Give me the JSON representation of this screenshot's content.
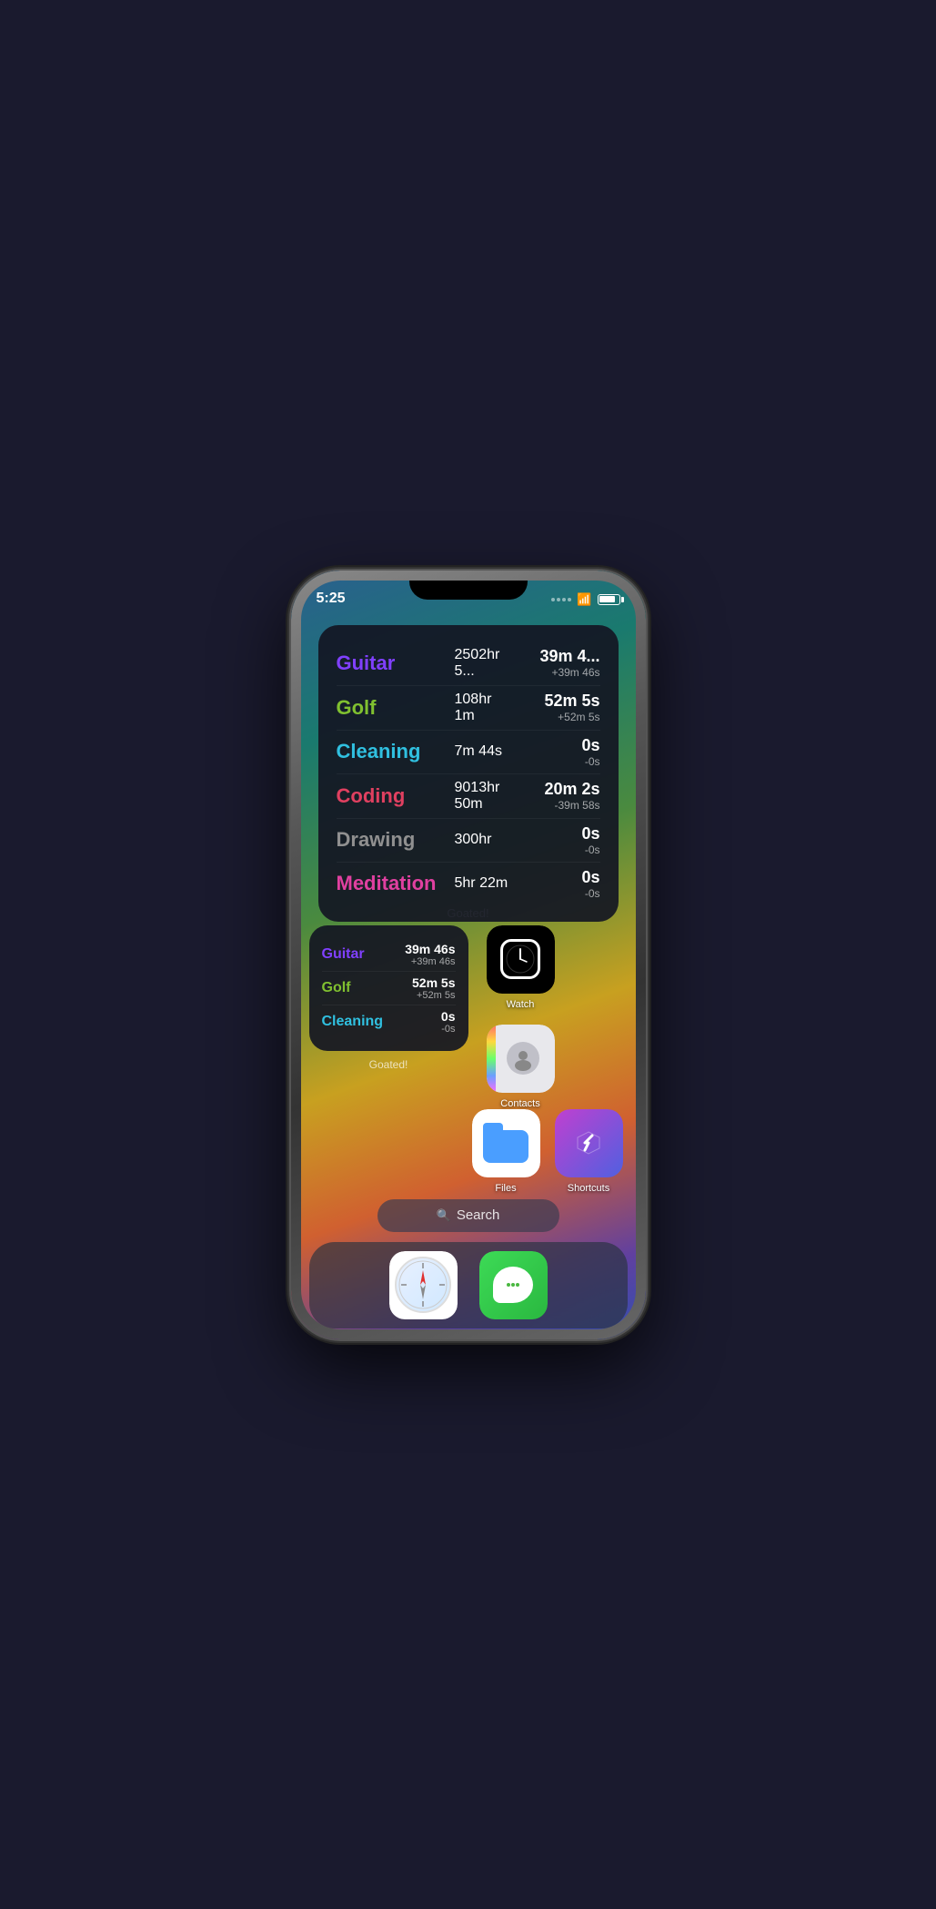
{
  "phone": {
    "time": "5:25"
  },
  "large_widget": {
    "label": "Goated!",
    "rows": [
      {
        "name": "Guitar",
        "color_class": "color-guitar",
        "total": "2502hr 5...",
        "today_main": "39m 4...",
        "today_sub": "+39m 46s"
      },
      {
        "name": "Golf",
        "color_class": "color-golf",
        "total": "108hr 1m",
        "today_main": "52m 5s",
        "today_sub": "+52m 5s"
      },
      {
        "name": "Cleaning",
        "color_class": "color-cleaning",
        "total": "7m 44s",
        "today_main": "0s",
        "today_sub": "-0s"
      },
      {
        "name": "Coding",
        "color_class": "color-coding",
        "total": "9013hr 50m",
        "today_main": "20m 2s",
        "today_sub": "-39m 58s"
      },
      {
        "name": "Drawing",
        "color_class": "color-drawing",
        "total": "300hr",
        "today_main": "0s",
        "today_sub": "-0s"
      },
      {
        "name": "Meditation",
        "color_class": "color-meditation",
        "total": "5hr 22m",
        "today_main": "0s",
        "today_sub": "-0s"
      }
    ]
  },
  "small_widget": {
    "label": "Goated!",
    "rows": [
      {
        "name": "Guitar",
        "color_class": "color-guitar",
        "today_main": "39m 46s",
        "today_sub": "+39m 46s"
      },
      {
        "name": "Golf",
        "color_class": "color-golf",
        "today_main": "52m 5s",
        "today_sub": "+52m 5s"
      },
      {
        "name": "Cleaning",
        "color_class": "color-cleaning",
        "today_main": "0s",
        "today_sub": "-0s"
      }
    ]
  },
  "apps": {
    "watch": {
      "label": "Watch"
    },
    "contacts": {
      "label": "Contacts"
    },
    "files": {
      "label": "Files"
    },
    "shortcuts": {
      "label": "Shortcuts"
    },
    "safari": {
      "label": "Safari"
    },
    "messages": {
      "label": "Messages"
    }
  },
  "search": {
    "placeholder": "Search",
    "icon": "🔍"
  }
}
